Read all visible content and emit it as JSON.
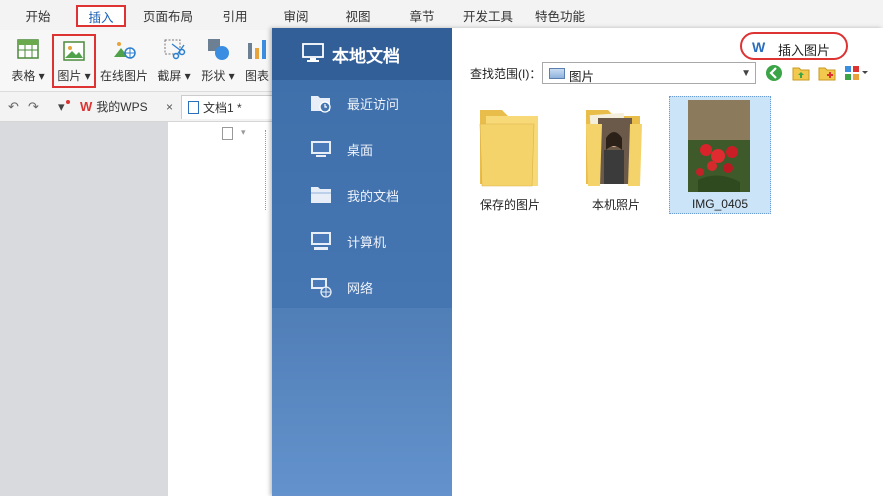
{
  "ribbon": {
    "tabs": [
      "开始",
      "插入",
      "页面布局",
      "引用",
      "审阅",
      "视图",
      "章节",
      "开发工具",
      "特色功能"
    ],
    "active_tab": "插入",
    "tools": [
      "表格",
      "图片",
      "在线图片",
      "截屏",
      "形状",
      "图表"
    ]
  },
  "quickbar": {
    "wps_tab": "我的WPS",
    "doc_tab": "文档1 *"
  },
  "dialog": {
    "sidebar_title": "本地文档",
    "sidebar_items": [
      "最近访问",
      "桌面",
      "我的文档",
      "计算机",
      "网络"
    ],
    "insert_button": "插入图片",
    "look_in_label": "查找范围(I)：",
    "look_in_value": "图片",
    "files": [
      {
        "name": "保存的图片",
        "kind": "folder"
      },
      {
        "name": "本机照片",
        "kind": "folder-photo"
      },
      {
        "name": "IMG_0405",
        "kind": "image"
      }
    ]
  },
  "colors": {
    "accent_red": "#dd3333",
    "sidebar_blue": "#4676b2",
    "folder_yellow": "#f5d36b"
  }
}
